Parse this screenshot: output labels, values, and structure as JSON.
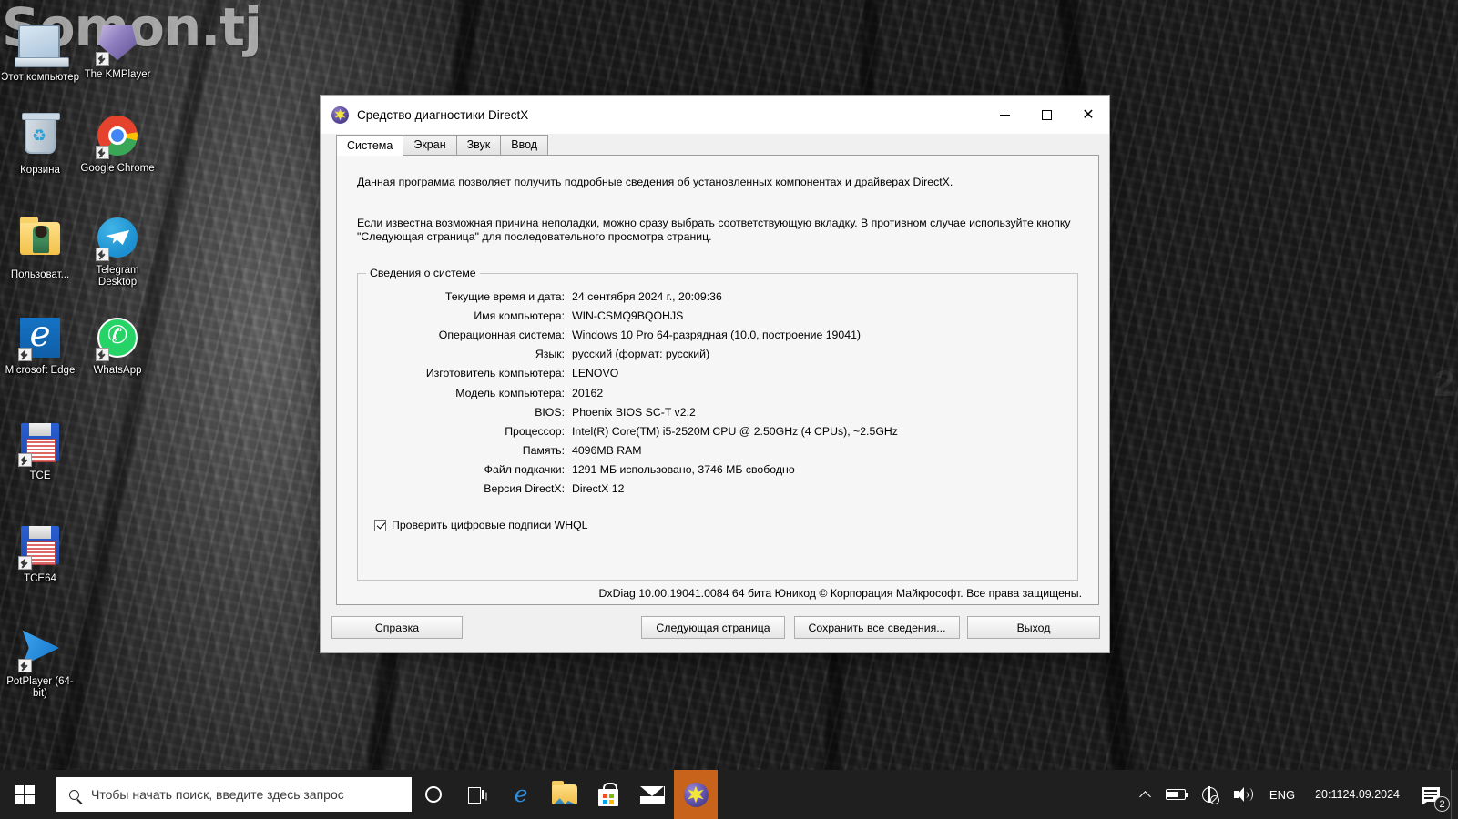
{
  "desktop": {
    "watermark": "Somon.tj",
    "watermark_right": "2",
    "icons": [
      {
        "label": "Этот компьютер",
        "art": "pc"
      },
      {
        "label": "The KMPlayer",
        "art": "kmp"
      },
      {
        "label": "Корзина",
        "art": "bin"
      },
      {
        "label": "Google Chrome",
        "art": "chrome"
      },
      {
        "label": "Пользоват...",
        "art": "folder"
      },
      {
        "label": "Telegram Desktop",
        "art": "telegram"
      },
      {
        "label": "Microsoft Edge",
        "art": "edge"
      },
      {
        "label": "WhatsApp",
        "art": "whatsapp"
      },
      {
        "label": "TCE",
        "art": "floppy"
      },
      {
        "label": "TCE64",
        "art": "floppy"
      },
      {
        "label": "PotPlayer (64-bit)",
        "art": "pot"
      }
    ]
  },
  "window": {
    "title": "Средство диагностики DirectX",
    "controls": {
      "minimize": "—",
      "maximize": "▢",
      "close": "✕"
    },
    "tabs": [
      {
        "label": "Система",
        "active": true
      },
      {
        "label": "Экран",
        "active": false
      },
      {
        "label": "Звук",
        "active": false
      },
      {
        "label": "Ввод",
        "active": false
      }
    ],
    "intro_paragraph_1": "Данная программа позволяет получить подробные сведения об установленных компонентах и драйверах DirectX.",
    "intro_paragraph_2": "Если известна возможная причина неполадки, можно сразу выбрать соответствующую вкладку. В противном случае используйте кнопку \"Следующая страница\" для последовательного просмотра страниц.",
    "sysinfo": {
      "legend": "Сведения о системе",
      "rows": [
        {
          "label": "Текущие время и дата:",
          "value": "24 сентября 2024 г., 20:09:36"
        },
        {
          "label": "Имя компьютера:",
          "value": "WIN-CSMQ9BQOHJS"
        },
        {
          "label": "Операционная система:",
          "value": "Windows 10 Pro 64-разрядная (10.0, построение 19041)"
        },
        {
          "label": "Язык:",
          "value": "русский (формат: русский)"
        },
        {
          "label": "Изготовитель компьютера:",
          "value": "LENOVO"
        },
        {
          "label": "Модель компьютера:",
          "value": "20162"
        },
        {
          "label": "BIOS:",
          "value": "Phoenix BIOS SC-T v2.2"
        },
        {
          "label": "Процессор:",
          "value": "Intel(R) Core(TM) i5-2520M CPU @ 2.50GHz (4 CPUs), ~2.5GHz"
        },
        {
          "label": "Память:",
          "value": "4096MB RAM"
        },
        {
          "label": "Файл подкачки:",
          "value": "1291 МБ использовано, 3746 МБ свободно"
        },
        {
          "label": "Версия DirectX:",
          "value": "DirectX 12"
        }
      ]
    },
    "whql_checkbox": {
      "label": "Проверить цифровые подписи WHQL",
      "checked": true
    },
    "copyright": "DxDiag 10.00.19041.0084 64 бита Юникод © Корпорация Майкрософт. Все права защищены.",
    "buttons": {
      "help": "Справка",
      "next_page": "Следующая страница",
      "save_all": "Сохранить все сведения...",
      "exit": "Выход"
    }
  },
  "taskbar": {
    "search_placeholder": "Чтобы начать поиск, введите здесь запрос",
    "language": "ENG",
    "time": "20:11",
    "date": "24.09.2024",
    "notification_count": "2"
  }
}
